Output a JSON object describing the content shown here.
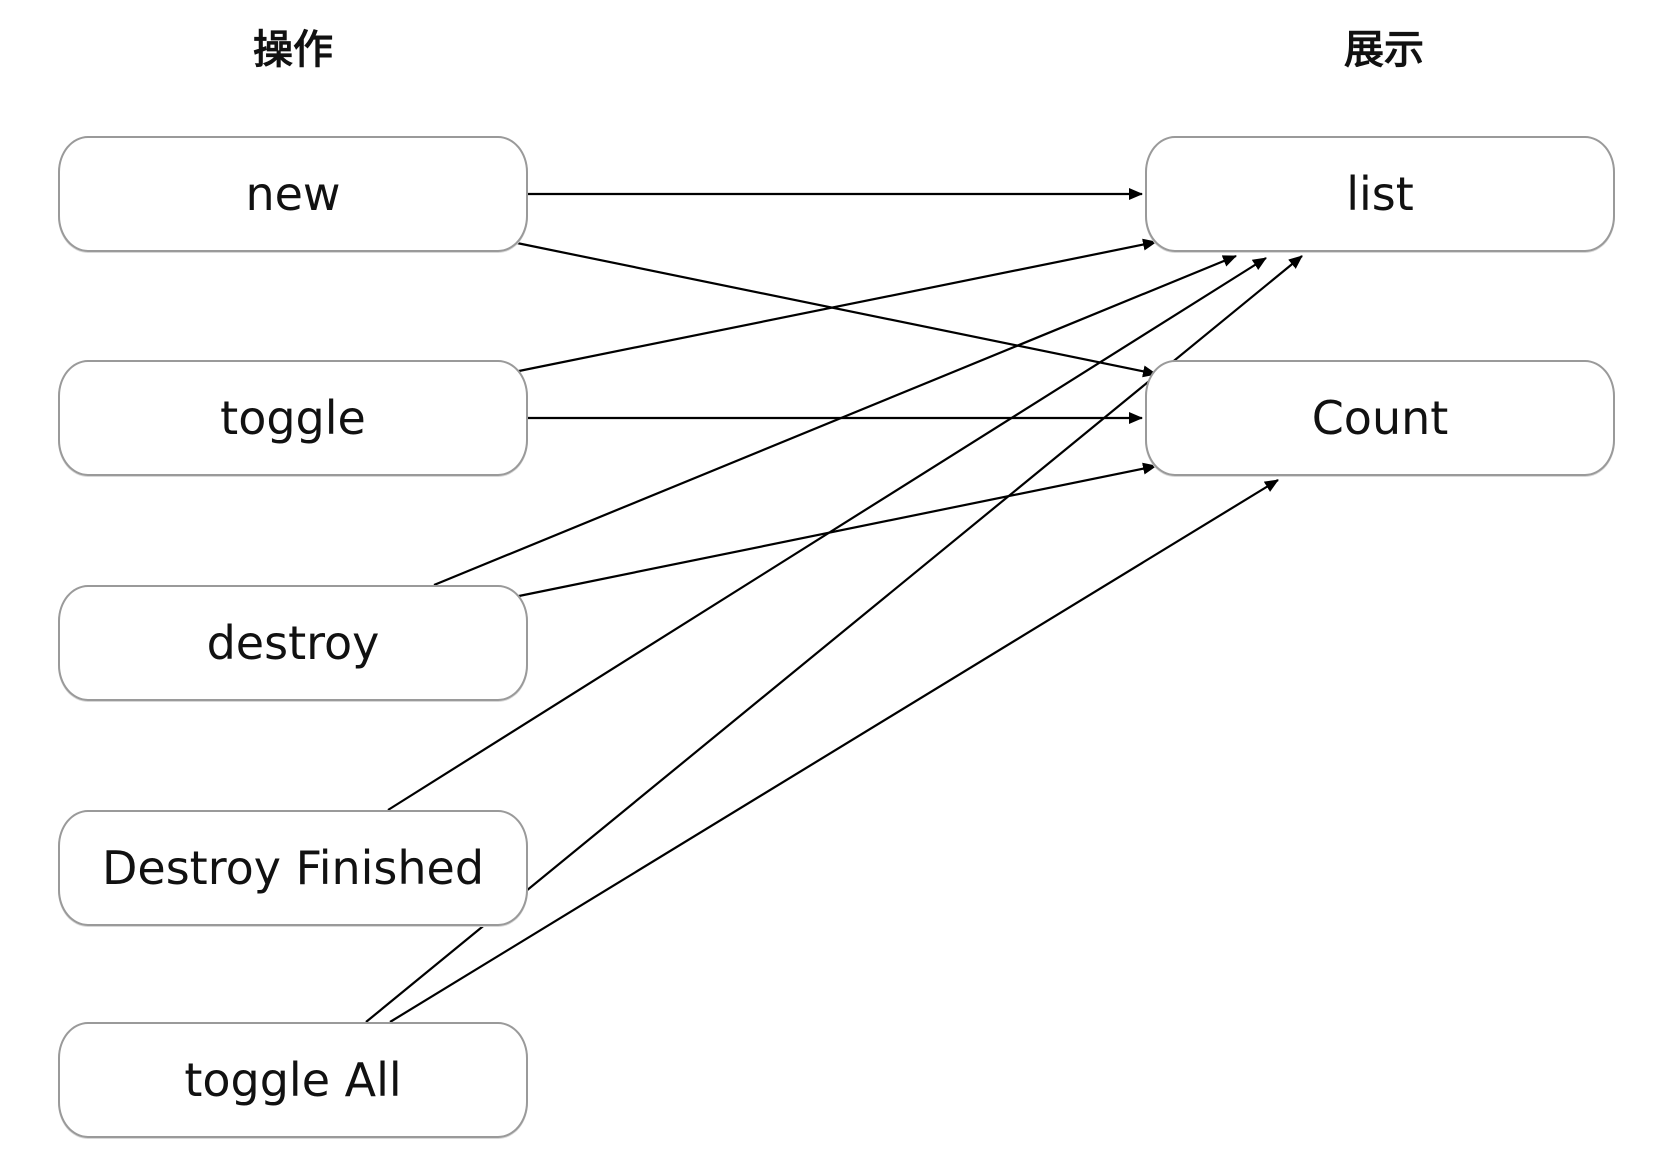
{
  "headers": {
    "left": "操作",
    "right": "展示"
  },
  "operations": {
    "new": "new",
    "toggle": "toggle",
    "destroy": "destroy",
    "destroy_finished": "Destroy Finished",
    "toggle_all": "toggle All"
  },
  "displays": {
    "list": "list",
    "count": "Count"
  },
  "edges": [
    {
      "from": "new",
      "to": "list"
    },
    {
      "from": "new",
      "to": "Count"
    },
    {
      "from": "toggle",
      "to": "list"
    },
    {
      "from": "toggle",
      "to": "Count"
    },
    {
      "from": "destroy",
      "to": "list"
    },
    {
      "from": "destroy",
      "to": "Count"
    },
    {
      "from": "Destroy Finished",
      "to": "list"
    },
    {
      "from": "toggle All",
      "to": "list"
    },
    {
      "from": "toggle All",
      "to": "Count"
    }
  ],
  "colors": {
    "node_border": "#9a9a9a",
    "edge": "#000000",
    "text": "#111111"
  }
}
